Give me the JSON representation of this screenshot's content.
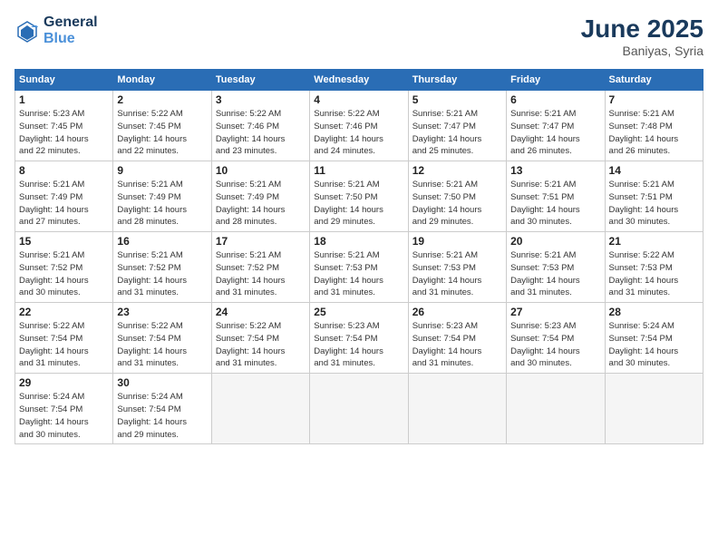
{
  "header": {
    "logo_line1": "General",
    "logo_line2": "Blue",
    "month": "June 2025",
    "location": "Baniyas, Syria"
  },
  "days_of_week": [
    "Sunday",
    "Monday",
    "Tuesday",
    "Wednesday",
    "Thursday",
    "Friday",
    "Saturday"
  ],
  "weeks": [
    [
      {
        "day": "1",
        "info": "Sunrise: 5:23 AM\nSunset: 7:45 PM\nDaylight: 14 hours\nand 22 minutes."
      },
      {
        "day": "2",
        "info": "Sunrise: 5:22 AM\nSunset: 7:45 PM\nDaylight: 14 hours\nand 22 minutes."
      },
      {
        "day": "3",
        "info": "Sunrise: 5:22 AM\nSunset: 7:46 PM\nDaylight: 14 hours\nand 23 minutes."
      },
      {
        "day": "4",
        "info": "Sunrise: 5:22 AM\nSunset: 7:46 PM\nDaylight: 14 hours\nand 24 minutes."
      },
      {
        "day": "5",
        "info": "Sunrise: 5:21 AM\nSunset: 7:47 PM\nDaylight: 14 hours\nand 25 minutes."
      },
      {
        "day": "6",
        "info": "Sunrise: 5:21 AM\nSunset: 7:47 PM\nDaylight: 14 hours\nand 26 minutes."
      },
      {
        "day": "7",
        "info": "Sunrise: 5:21 AM\nSunset: 7:48 PM\nDaylight: 14 hours\nand 26 minutes."
      }
    ],
    [
      {
        "day": "8",
        "info": "Sunrise: 5:21 AM\nSunset: 7:49 PM\nDaylight: 14 hours\nand 27 minutes."
      },
      {
        "day": "9",
        "info": "Sunrise: 5:21 AM\nSunset: 7:49 PM\nDaylight: 14 hours\nand 28 minutes."
      },
      {
        "day": "10",
        "info": "Sunrise: 5:21 AM\nSunset: 7:49 PM\nDaylight: 14 hours\nand 28 minutes."
      },
      {
        "day": "11",
        "info": "Sunrise: 5:21 AM\nSunset: 7:50 PM\nDaylight: 14 hours\nand 29 minutes."
      },
      {
        "day": "12",
        "info": "Sunrise: 5:21 AM\nSunset: 7:50 PM\nDaylight: 14 hours\nand 29 minutes."
      },
      {
        "day": "13",
        "info": "Sunrise: 5:21 AM\nSunset: 7:51 PM\nDaylight: 14 hours\nand 30 minutes."
      },
      {
        "day": "14",
        "info": "Sunrise: 5:21 AM\nSunset: 7:51 PM\nDaylight: 14 hours\nand 30 minutes."
      }
    ],
    [
      {
        "day": "15",
        "info": "Sunrise: 5:21 AM\nSunset: 7:52 PM\nDaylight: 14 hours\nand 30 minutes."
      },
      {
        "day": "16",
        "info": "Sunrise: 5:21 AM\nSunset: 7:52 PM\nDaylight: 14 hours\nand 31 minutes."
      },
      {
        "day": "17",
        "info": "Sunrise: 5:21 AM\nSunset: 7:52 PM\nDaylight: 14 hours\nand 31 minutes."
      },
      {
        "day": "18",
        "info": "Sunrise: 5:21 AM\nSunset: 7:53 PM\nDaylight: 14 hours\nand 31 minutes."
      },
      {
        "day": "19",
        "info": "Sunrise: 5:21 AM\nSunset: 7:53 PM\nDaylight: 14 hours\nand 31 minutes."
      },
      {
        "day": "20",
        "info": "Sunrise: 5:21 AM\nSunset: 7:53 PM\nDaylight: 14 hours\nand 31 minutes."
      },
      {
        "day": "21",
        "info": "Sunrise: 5:22 AM\nSunset: 7:53 PM\nDaylight: 14 hours\nand 31 minutes."
      }
    ],
    [
      {
        "day": "22",
        "info": "Sunrise: 5:22 AM\nSunset: 7:54 PM\nDaylight: 14 hours\nand 31 minutes."
      },
      {
        "day": "23",
        "info": "Sunrise: 5:22 AM\nSunset: 7:54 PM\nDaylight: 14 hours\nand 31 minutes."
      },
      {
        "day": "24",
        "info": "Sunrise: 5:22 AM\nSunset: 7:54 PM\nDaylight: 14 hours\nand 31 minutes."
      },
      {
        "day": "25",
        "info": "Sunrise: 5:23 AM\nSunset: 7:54 PM\nDaylight: 14 hours\nand 31 minutes."
      },
      {
        "day": "26",
        "info": "Sunrise: 5:23 AM\nSunset: 7:54 PM\nDaylight: 14 hours\nand 31 minutes."
      },
      {
        "day": "27",
        "info": "Sunrise: 5:23 AM\nSunset: 7:54 PM\nDaylight: 14 hours\nand 30 minutes."
      },
      {
        "day": "28",
        "info": "Sunrise: 5:24 AM\nSunset: 7:54 PM\nDaylight: 14 hours\nand 30 minutes."
      }
    ],
    [
      {
        "day": "29",
        "info": "Sunrise: 5:24 AM\nSunset: 7:54 PM\nDaylight: 14 hours\nand 30 minutes."
      },
      {
        "day": "30",
        "info": "Sunrise: 5:24 AM\nSunset: 7:54 PM\nDaylight: 14 hours\nand 29 minutes."
      },
      {
        "day": "",
        "info": ""
      },
      {
        "day": "",
        "info": ""
      },
      {
        "day": "",
        "info": ""
      },
      {
        "day": "",
        "info": ""
      },
      {
        "day": "",
        "info": ""
      }
    ]
  ]
}
